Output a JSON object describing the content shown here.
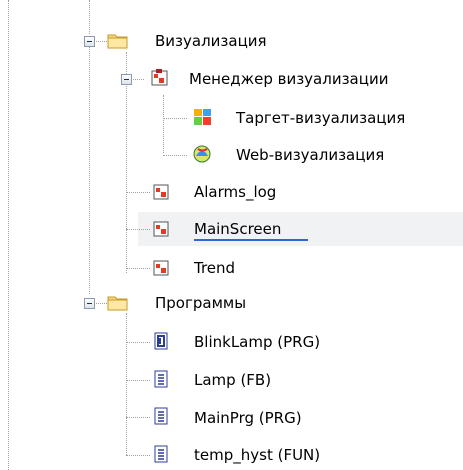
{
  "tree": {
    "visualization_folder": "Визуализация",
    "visualization_manager": "Менеджер визуализации",
    "target_visualization": "Таргет-визуализация",
    "web_visualization": "Web-визуализация",
    "alarms_log": "Alarms_log",
    "main_screen": "MainScreen",
    "trend": "Trend",
    "programs_folder": "Программы",
    "blinklamp": "BlinkLamp (PRG)",
    "lamp": "Lamp (FB)",
    "mainprg": "MainPrg (PRG)",
    "temp_hyst": "temp_hyst (FUN)"
  },
  "colors": {
    "folder": "#f4d37a",
    "selection_underline": "#2f66d8",
    "selection_band": "#f0f2f4"
  },
  "icons": {
    "folder": "folder-icon",
    "visualization": "visualization-icon",
    "manager": "visualization-manager-icon",
    "target": "target-visualization-icon",
    "web": "web-visualization-icon",
    "program": "program-icon",
    "function_block": "function-block-icon",
    "function": "function-icon"
  }
}
